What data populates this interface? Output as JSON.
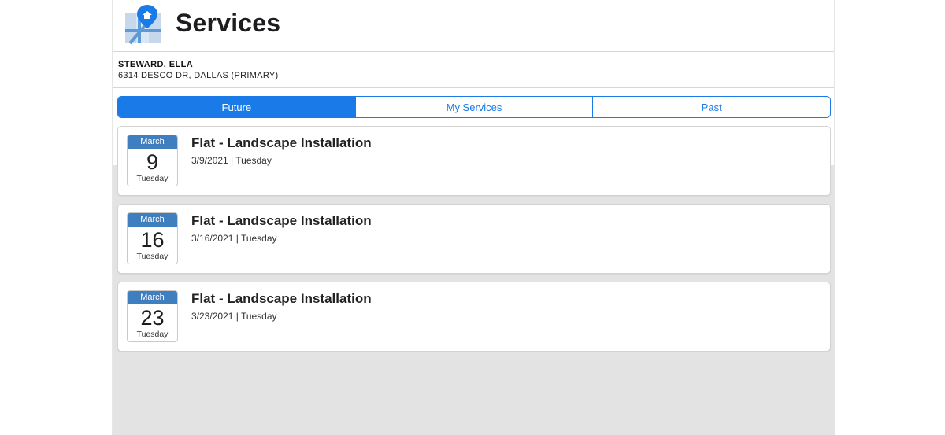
{
  "header": {
    "title": "Services"
  },
  "customer": {
    "name": "STEWARD, ELLA",
    "address": "6314 DESCO DR, DALLAS (PRIMARY)"
  },
  "tabs": [
    {
      "label": "Future",
      "active": true
    },
    {
      "label": "My Services",
      "active": false
    },
    {
      "label": "Past",
      "active": false
    }
  ],
  "services": [
    {
      "month": "March",
      "day": "9",
      "weekday": "Tuesday",
      "title": "Flat - Landscape Installation",
      "date_line": "3/9/2021 | Tuesday"
    },
    {
      "month": "March",
      "day": "16",
      "weekday": "Tuesday",
      "title": "Flat - Landscape Installation",
      "date_line": "3/16/2021 | Tuesday"
    },
    {
      "month": "March",
      "day": "23",
      "weekday": "Tuesday",
      "title": "Flat - Landscape Installation",
      "date_line": "3/23/2021 | Tuesday"
    }
  ],
  "colors": {
    "accent": "#1a7be8",
    "calendar_header": "#3f7fc0",
    "background": "#e3e3e3"
  },
  "icons": {
    "app_logo": "map-pin-home-icon"
  }
}
